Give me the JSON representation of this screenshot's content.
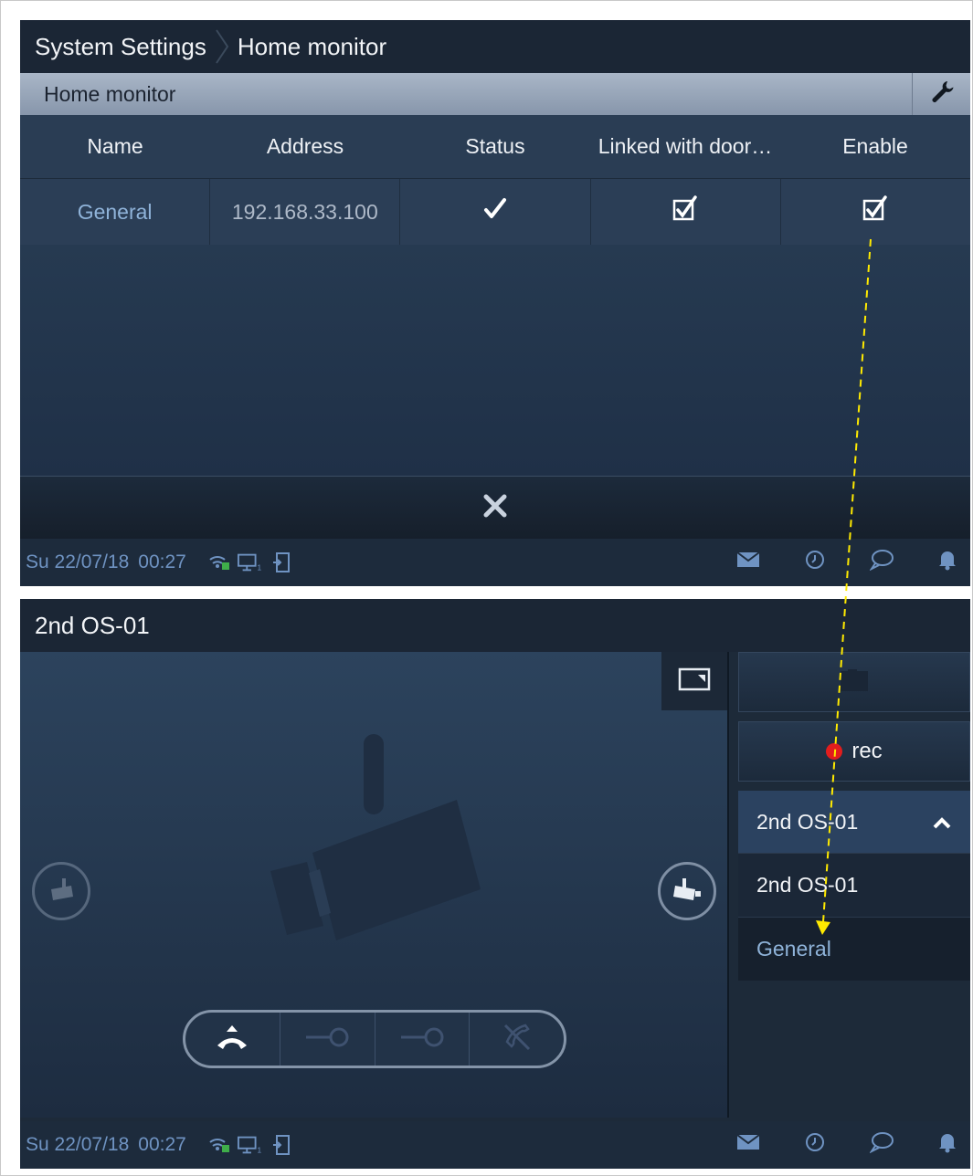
{
  "top_screen": {
    "breadcrumb": {
      "root": "System Settings",
      "current": "Home monitor"
    },
    "subheader": {
      "title": "Home monitor",
      "wrench_icon": "wrench-icon"
    },
    "table": {
      "columns": [
        "Name",
        "Address",
        "Status",
        "Linked with door…",
        "Enable"
      ],
      "rows": [
        {
          "name": "General",
          "address": "192.168.33.100",
          "status": "check",
          "linked": "checked",
          "enable": "checked"
        }
      ]
    },
    "close_icon": "close-icon",
    "statusbar": {
      "date": "Su 22/07/18",
      "time": "00:27"
    }
  },
  "bottom_screen": {
    "title": "2nd OS-01",
    "side": {
      "rec_label": "rec",
      "dropdown": {
        "selected": "2nd OS-01",
        "options": [
          "2nd OS-01",
          "General"
        ]
      }
    },
    "statusbar": {
      "date": "Su 22/07/18",
      "time": "00:27"
    }
  },
  "colors": {
    "accent": "#8fb3d9",
    "background": "#1d2a39",
    "rec_dot": "#e21d1d",
    "annotation_arrow": "#ffea00"
  },
  "icons": [
    "wrench-icon",
    "check-icon",
    "checkbox-checked-icon",
    "close-icon",
    "wifi-icon",
    "monitor-icon",
    "door-icon",
    "mail-icon",
    "history-icon",
    "chat-icon",
    "bell-icon",
    "pip-icon",
    "camera-pan-left-icon",
    "camera-pan-right-icon",
    "hangup-icon",
    "key-icon",
    "mute-icon",
    "chevron-up-icon",
    "snapshot-icon"
  ]
}
